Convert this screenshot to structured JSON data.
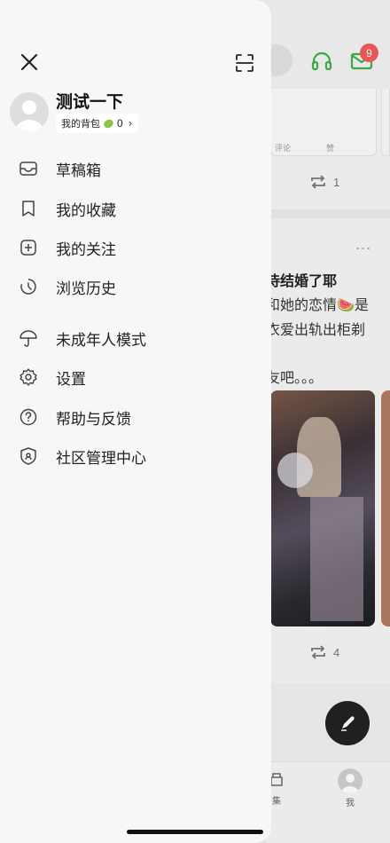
{
  "background": {
    "badge_count": "9",
    "mini_card": {
      "comment_label": "评论",
      "like_label": "赞"
    },
    "repost1_count": "1",
    "post": {
      "more": "...",
      "title": "侍结婚了耶",
      "line1": "和她的恋情🍉是",
      "line2": "衣爱出轨出柜剃",
      "line3": "友吧。。。"
    },
    "repost2_count": "4",
    "tabs": {
      "collect": "集",
      "me": "我"
    }
  },
  "drawer": {
    "profile": {
      "username": "测试一下",
      "backpack_label": "我的背包",
      "backpack_count": "0"
    },
    "menu": [
      {
        "label": "草稿箱",
        "icon": "drafts-icon"
      },
      {
        "label": "我的收藏",
        "icon": "bookmark-icon"
      },
      {
        "label": "我的关注",
        "icon": "plus-square-icon"
      },
      {
        "label": "浏览历史",
        "icon": "history-icon"
      },
      {
        "label": "未成年人模式",
        "icon": "umbrella-icon"
      },
      {
        "label": "设置",
        "icon": "gear-icon"
      },
      {
        "label": "帮助与反馈",
        "icon": "help-icon"
      },
      {
        "label": "社区管理中心",
        "icon": "shield-icon"
      }
    ]
  },
  "colors": {
    "badge": "#f25b5b",
    "accent_green": "#3fae49",
    "drawer_bg": "#f7f7f7"
  }
}
